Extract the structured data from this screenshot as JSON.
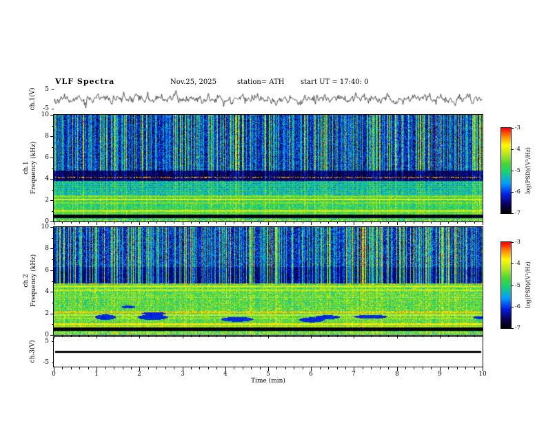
{
  "title": "VLF  Spectra",
  "header": {
    "date": "Nov.25, 2025",
    "station": "station= ATH",
    "start_ut": "start UT =  17:40: 0"
  },
  "axes": {
    "x": {
      "label": "Time  (min)",
      "min": 0,
      "max": 10,
      "major_ticks": [
        0,
        1,
        2,
        3,
        4,
        5,
        6,
        7,
        8,
        9,
        10
      ],
      "minor_step": 0.2
    }
  },
  "colorbar": {
    "label": "log(PSD)/(V²/Hz)",
    "min": -7,
    "max": -3,
    "ticks": [
      -3,
      -4,
      -5,
      -6,
      -7
    ]
  },
  "colormap": [
    {
      "t": 0.0,
      "c": "#000000"
    },
    {
      "t": 0.1,
      "c": "#0a005a"
    },
    {
      "t": 0.22,
      "c": "#001ee6"
    },
    {
      "t": 0.35,
      "c": "#00a0ff"
    },
    {
      "t": 0.48,
      "c": "#14d278"
    },
    {
      "t": 0.58,
      "c": "#46d732"
    },
    {
      "t": 0.7,
      "c": "#bee61e"
    },
    {
      "t": 0.8,
      "c": "#fffa00"
    },
    {
      "t": 0.9,
      "c": "#ff8c00"
    },
    {
      "t": 1.0,
      "c": "#ff0000"
    }
  ],
  "chart_data": [
    {
      "id": "ch1_wave",
      "type": "line",
      "ylabel": "ch.1(V)",
      "ylim": [
        -5,
        5
      ],
      "yticks": [
        5,
        -5
      ],
      "seed": 11,
      "gen": {
        "std": 1.0,
        "persist": 0.5,
        "spike_prob": 0.03,
        "spike_amp": 3.0
      }
    },
    {
      "id": "ch1_spec",
      "type": "heatmap",
      "ylabel_lines": [
        "ch.1",
        "Frequency  (kHz)"
      ],
      "ylim": [
        0,
        10
      ],
      "yticks": [
        10,
        8,
        6,
        4,
        2,
        0
      ],
      "clim": [
        -7,
        -3
      ],
      "seed": 21,
      "bands": [
        {
          "f0": 10,
          "f1": 4.75,
          "level": -6.25,
          "noise": 0.45
        },
        {
          "f0": 4.75,
          "f1": 3.8,
          "level": -6.7,
          "noise": 0.25
        },
        {
          "f0": 3.8,
          "f1": 2.2,
          "level": -5.3,
          "noise": 0.35,
          "stripe": 0.35
        },
        {
          "f0": 2.2,
          "f1": 0.62,
          "level": -5.0,
          "noise": 0.4
        },
        {
          "f0": 0.62,
          "f1": 0.3,
          "level": -7.2,
          "noise": 0.1
        },
        {
          "f0": 0.3,
          "f1": 0,
          "level": -5.1,
          "noise": 0.45
        }
      ],
      "lines": [
        {
          "f": 4.12,
          "level": -3.5,
          "w": 0.07,
          "dot": 0.55
        },
        {
          "f": 2.35,
          "level": -4.4,
          "w": 0.07
        },
        {
          "f": 2.05,
          "level": -3.9,
          "w": 0.08
        },
        {
          "f": 1.75,
          "level": -4.5,
          "w": 0.06
        },
        {
          "f": 1.0,
          "level": -4.2,
          "w": 0.08
        },
        {
          "f": 0.8,
          "level": -4.6,
          "w": 0.06
        },
        {
          "f": 0.15,
          "level": -3.7,
          "w": 0.07,
          "dot": 0.5
        }
      ],
      "streaks": {
        "density": 0.5,
        "fmin": 4.75,
        "smin": 0.4,
        "smax": 2.6,
        "leak": 0.25
      }
    },
    {
      "id": "ch2_spec",
      "type": "heatmap",
      "ylabel_lines": [
        "ch.2",
        "Frequency  (kHz)"
      ],
      "ylim": [
        0,
        10
      ],
      "yticks": [
        10,
        8,
        6,
        4,
        2,
        0
      ],
      "clim": [
        -7,
        -3
      ],
      "seed": 33,
      "bands": [
        {
          "f0": 10,
          "f1": 6.3,
          "level": -6.2,
          "noise": 0.45
        },
        {
          "f0": 6.3,
          "f1": 4.75,
          "level": -6.5,
          "noise": 0.3
        },
        {
          "f0": 4.75,
          "f1": 4.35,
          "level": -5.1,
          "noise": 0.4
        },
        {
          "f0": 4.35,
          "f1": 0.7,
          "level": -4.75,
          "noise": 0.45,
          "stripe": 0.3
        },
        {
          "f0": 0.7,
          "f1": 0.38,
          "level": -7.2,
          "noise": 0.1
        },
        {
          "f0": 0.38,
          "f1": 0,
          "level": -4.9,
          "noise": 0.5
        }
      ],
      "lines": [
        {
          "f": 4.72,
          "level": -3.6,
          "w": 0.07,
          "dot": 0.5
        },
        {
          "f": 4.5,
          "level": -4.1,
          "w": 0.08
        },
        {
          "f": 4.15,
          "level": -4.2,
          "w": 0.07
        },
        {
          "f": 3.5,
          "level": -4.5,
          "w": 0.06
        },
        {
          "f": 2.1,
          "level": -3.6,
          "w": 0.09
        },
        {
          "f": 1.85,
          "level": -4.0,
          "w": 0.07
        },
        {
          "f": 1.55,
          "level": -4.4,
          "w": 0.06
        },
        {
          "f": 1.0,
          "level": -3.8,
          "w": 0.08
        },
        {
          "f": 0.75,
          "level": -4.3,
          "w": 0.06
        },
        {
          "f": 0.2,
          "level": -3.7,
          "w": 0.07,
          "dot": 0.5
        }
      ],
      "streaks": {
        "density": 0.5,
        "fmin": 4.75,
        "smin": 0.4,
        "smax": 2.6,
        "leak": 0.2
      },
      "blobs": {
        "count": 9,
        "f": 2.0,
        "spread": 0.6,
        "level": -6.3
      }
    },
    {
      "id": "ch3_wave",
      "type": "flat",
      "ylabel": "ch.3(V)",
      "ylim": [
        -7,
        7
      ],
      "yticks": [
        5,
        -5
      ],
      "value": 0
    }
  ]
}
